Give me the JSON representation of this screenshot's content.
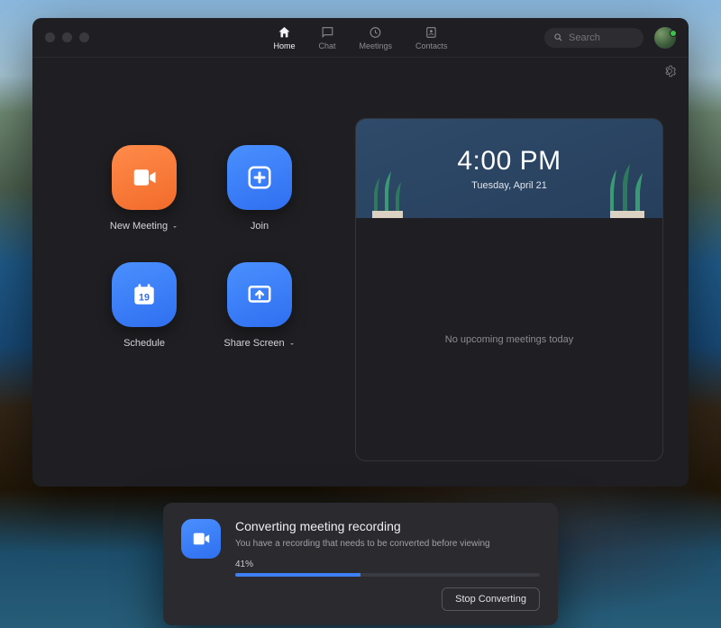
{
  "nav": {
    "home": "Home",
    "chat": "Chat",
    "meetings": "Meetings",
    "contacts": "Contacts"
  },
  "search": {
    "placeholder": "Search"
  },
  "actions": {
    "new_meeting": "New Meeting",
    "join": "Join",
    "schedule": "Schedule",
    "share_screen": "Share Screen",
    "calendar_day": "19"
  },
  "calendar": {
    "time": "4:00 PM",
    "date": "Tuesday, April 21",
    "empty": "No upcoming meetings today"
  },
  "dialog": {
    "title": "Converting meeting recording",
    "subtitle": "You have a recording that needs to be converted before viewing",
    "percent_label": "41%",
    "percent_value": 41,
    "stop": "Stop Converting"
  }
}
